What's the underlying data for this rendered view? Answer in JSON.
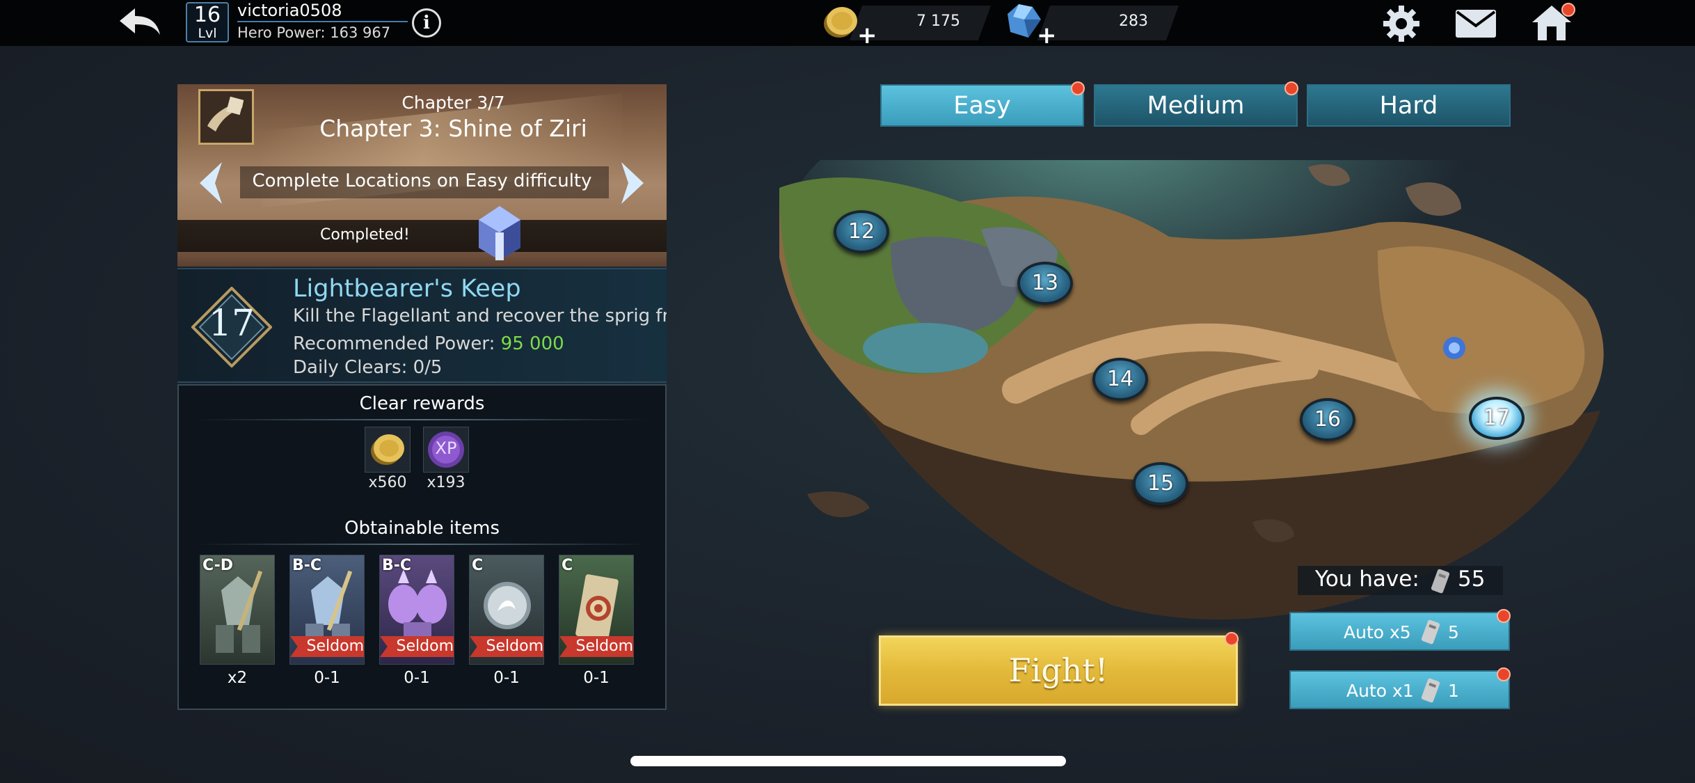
{
  "header": {
    "level_number": "16",
    "level_label": "Lvl",
    "username": "victoria0508",
    "hero_power": "Hero Power: 163 967",
    "coins": "7 175",
    "gems": "283"
  },
  "chapter": {
    "count": "Chapter 3/7",
    "title": "Chapter 3: Shine of Ziri",
    "task": "Complete Locations on Easy difficulty",
    "status": "Completed!"
  },
  "location": {
    "number": "17",
    "title": "Lightbearer's Keep",
    "description": "Kill the Flagellant and recover the sprig fr",
    "power_label": "Recommended Power:",
    "power_value": "95 000",
    "clears_label": "Daily Clears:",
    "clears_value": "0/5"
  },
  "rewards": {
    "clear_title": "Clear rewards",
    "clear_items": [
      {
        "icon": "coin-icon",
        "qty": "x560"
      },
      {
        "icon": "xp-icon",
        "label": "XP",
        "qty": "x193"
      }
    ],
    "obtainable_title": "Obtainable items",
    "items": [
      {
        "grade": "C-D",
        "tag": "",
        "qty": "x2",
        "icon": "armor-set-icon",
        "bg": "#4a5a4c"
      },
      {
        "grade": "B-C",
        "tag": "Seldom",
        "qty": "0-1",
        "icon": "armor-set-icon",
        "bg": "#3c4e66"
      },
      {
        "grade": "B-C",
        "tag": "Seldom",
        "qty": "0-1",
        "icon": "crystal-pauldrons-icon",
        "bg": "#4a3e66"
      },
      {
        "grade": "C",
        "tag": "Seldom",
        "qty": "0-1",
        "icon": "orb-icon",
        "bg": "#3e4a4e"
      },
      {
        "grade": "C",
        "tag": "Seldom",
        "qty": "0-1",
        "icon": "target-scroll-icon",
        "bg": "#3e5a40"
      }
    ]
  },
  "difficulty": {
    "tabs": [
      {
        "label": "Easy",
        "active": true,
        "badge": true
      },
      {
        "label": "Medium",
        "active": false,
        "badge": true
      },
      {
        "label": "Hard",
        "active": false,
        "badge": false
      }
    ]
  },
  "map": {
    "nodes": [
      "12",
      "13",
      "14",
      "15",
      "16",
      "17"
    ],
    "active_node": "17"
  },
  "actions": {
    "you_have_label": "You have:",
    "tickets": "55",
    "auto_x5_label": "Auto x5",
    "auto_x5_cost": "5",
    "auto_x1_label": "Auto x1",
    "auto_x1_cost": "1",
    "fight_label": "Fight!"
  },
  "colors": {
    "accent_blue": "#5cc2de",
    "power_green": "#7ddc4a",
    "fight_gold": "#e3b93a",
    "badge_red": "#e8452a"
  }
}
